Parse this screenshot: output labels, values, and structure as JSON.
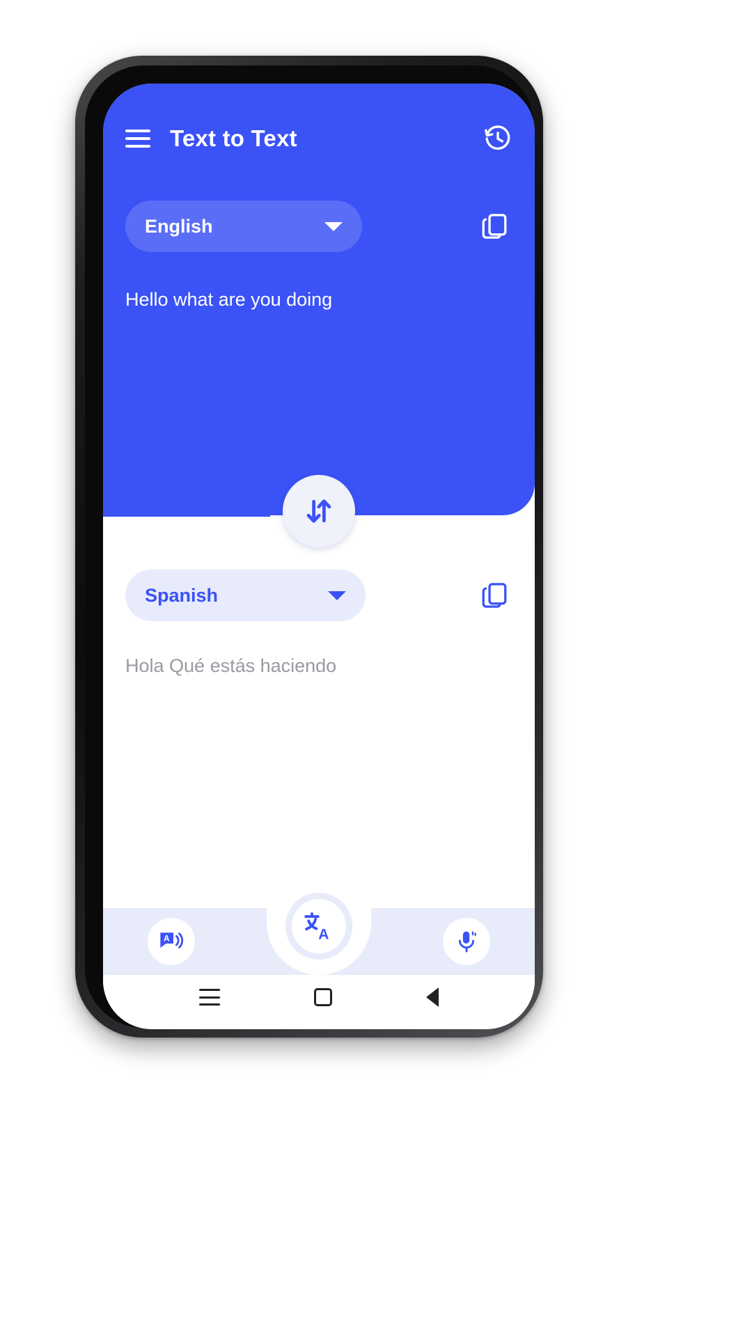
{
  "app": {
    "title": "Text to Text",
    "menu_icon": "hamburger-menu-icon",
    "history_icon": "history-clock-icon",
    "accent_color": "#3b52f6",
    "panel_light_color": "#e8ebfc",
    "placeholder_text_color": "#9a9aa2"
  },
  "source": {
    "language": "English",
    "text": "Hello what are you doing",
    "copy_icon": "copy-icon",
    "dropdown_icon": "chevron-down-icon"
  },
  "swap": {
    "icon": "swap-vertical-arrows-icon"
  },
  "target": {
    "language": "Spanish",
    "text": "Hola Qué estás haciendo",
    "copy_icon": "copy-icon",
    "dropdown_icon": "chevron-down-icon"
  },
  "bottom_bar": {
    "speak_icon": "text-to-speech-icon",
    "translate_icon": "translate-language-icon",
    "mic_icon": "microphone-icon"
  },
  "system_nav": {
    "recent_icon": "recent-apps-icon",
    "home_icon": "home-square-icon",
    "back_icon": "back-triangle-icon"
  }
}
